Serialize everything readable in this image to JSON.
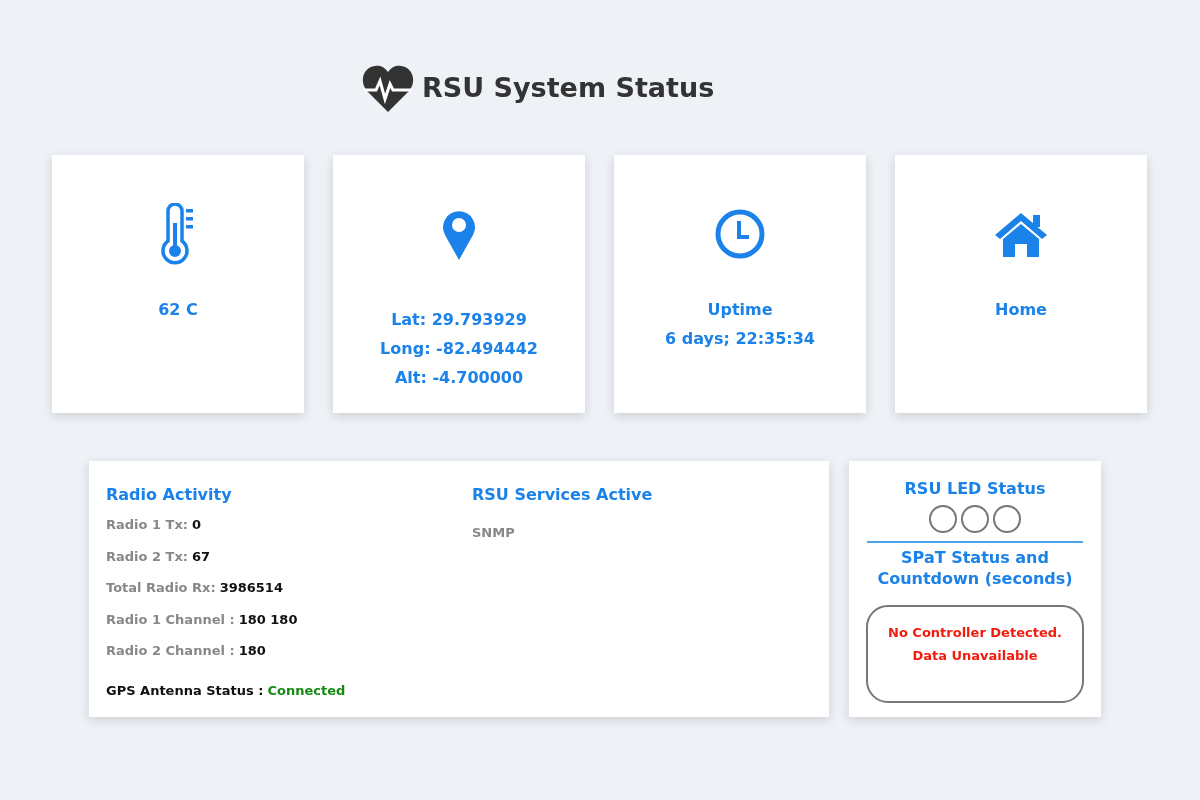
{
  "header": {
    "title": "RSU System Status"
  },
  "cards": [
    {
      "kind": "thermometer",
      "lines": [
        "62 C"
      ]
    },
    {
      "kind": "pin",
      "lines": [
        "Lat: 29.793929",
        "Long: -82.494442",
        "Alt: -4.700000"
      ]
    },
    {
      "kind": "clock",
      "lines": [
        "Uptime",
        "6 days; 22:35:34"
      ]
    },
    {
      "kind": "home",
      "lines": [
        "Home"
      ]
    }
  ],
  "radio_activity": {
    "title": "Radio Activity",
    "items": [
      {
        "label": "Radio 1 Tx:",
        "value": "0"
      },
      {
        "label": "Radio 2 Tx:",
        "value": "67"
      },
      {
        "label": "Total Radio Rx:",
        "value": "3986514"
      },
      {
        "label": "Radio 1 Channel :",
        "value": "180 180"
      },
      {
        "label": "Radio 2 Channel :",
        "value": "180"
      }
    ],
    "gps": {
      "label": "GPS Antenna Status :",
      "value": "Connected",
      "connected": true
    }
  },
  "services": {
    "title": "RSU Services Active",
    "items": [
      "SNMP"
    ]
  },
  "led_status": {
    "title": "RSU LED Status",
    "leds": [
      {
        "on": false
      },
      {
        "on": false
      },
      {
        "on": false
      }
    ]
  },
  "spat": {
    "title": "SPaT Status and Countdown (seconds)",
    "messages": [
      "No Controller Detected.",
      "Data Unavailable"
    ]
  }
}
